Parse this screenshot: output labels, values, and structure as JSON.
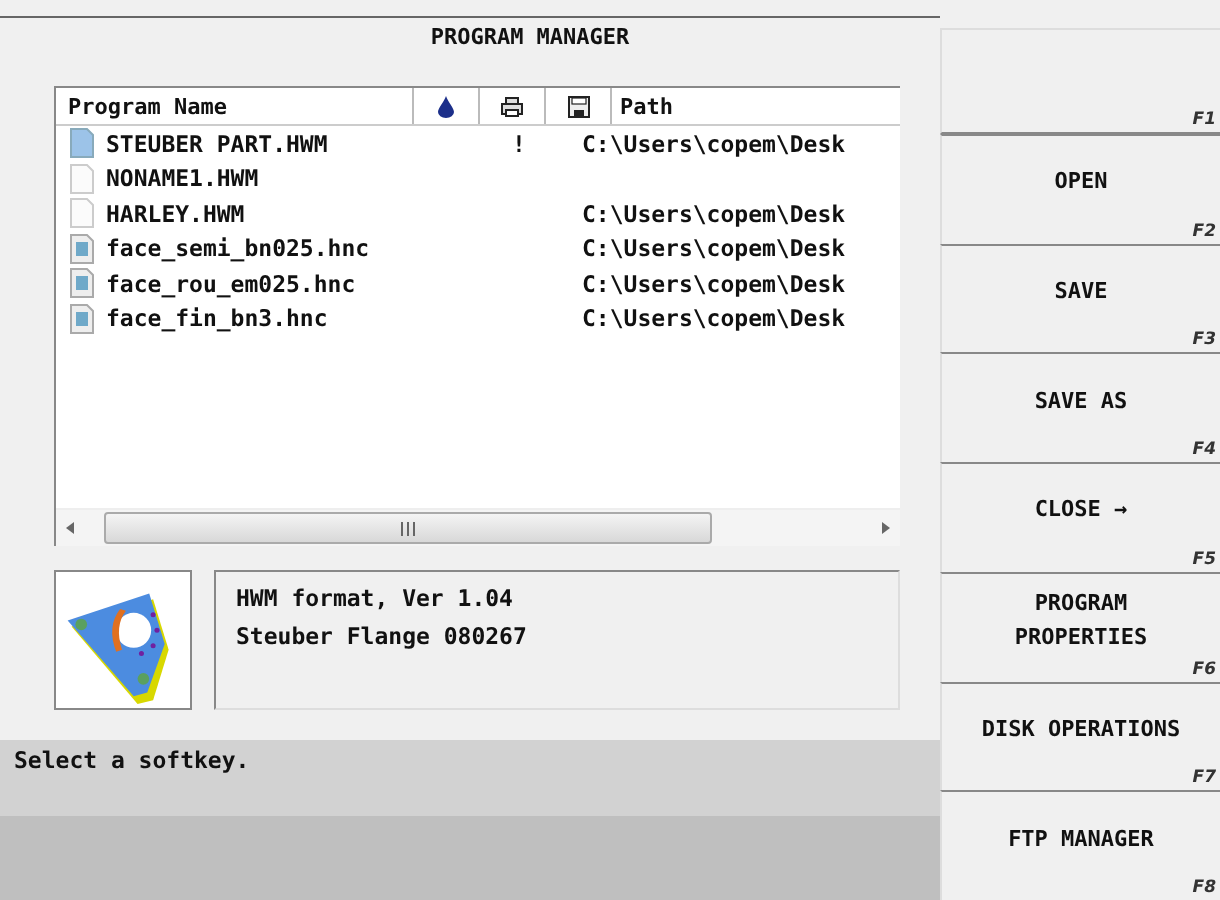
{
  "title": "PROGRAM MANAGER",
  "table": {
    "columns": [
      "Program Name",
      "Path"
    ],
    "rows": [
      {
        "kind": "hwm-current",
        "name": "STEUBER PART.HWM",
        "flag": "!",
        "path": "C:\\Users\\copem\\Desk"
      },
      {
        "kind": "hwm",
        "name": "NONAME1.HWM"
      },
      {
        "kind": "hwm",
        "name": "HARLEY.HWM",
        "path": "C:\\Users\\copem\\Desk"
      },
      {
        "kind": "hnc",
        "name": "face_semi_bn025.hnc",
        "path": "C:\\Users\\copem\\Desk"
      },
      {
        "kind": "hnc",
        "name": "face_rou_em025.hnc",
        "path": "C:\\Users\\copem\\Desk"
      },
      {
        "kind": "hnc",
        "name": "face_fin_bn3.hnc",
        "path": "C:\\Users\\copem\\Desk"
      }
    ]
  },
  "info": [
    "HWM format, Ver 1.04",
    "Steuber Flange 080267"
  ],
  "status": "Select a softkey.",
  "softkeys": [
    {
      "key": "F1"
    },
    {
      "label": "OPEN",
      "key": "F2"
    },
    {
      "label": "SAVE",
      "key": "F3"
    },
    {
      "label": "SAVE AS",
      "key": "F4"
    },
    {
      "label": "CLOSE →",
      "key": "F5"
    },
    {
      "label": "PROGRAM PROPERTIES",
      "key": "F6"
    },
    {
      "label": "DISK OPERATIONS",
      "key": "F7"
    },
    {
      "label": "FTP MANAGER",
      "key": "F8"
    }
  ]
}
